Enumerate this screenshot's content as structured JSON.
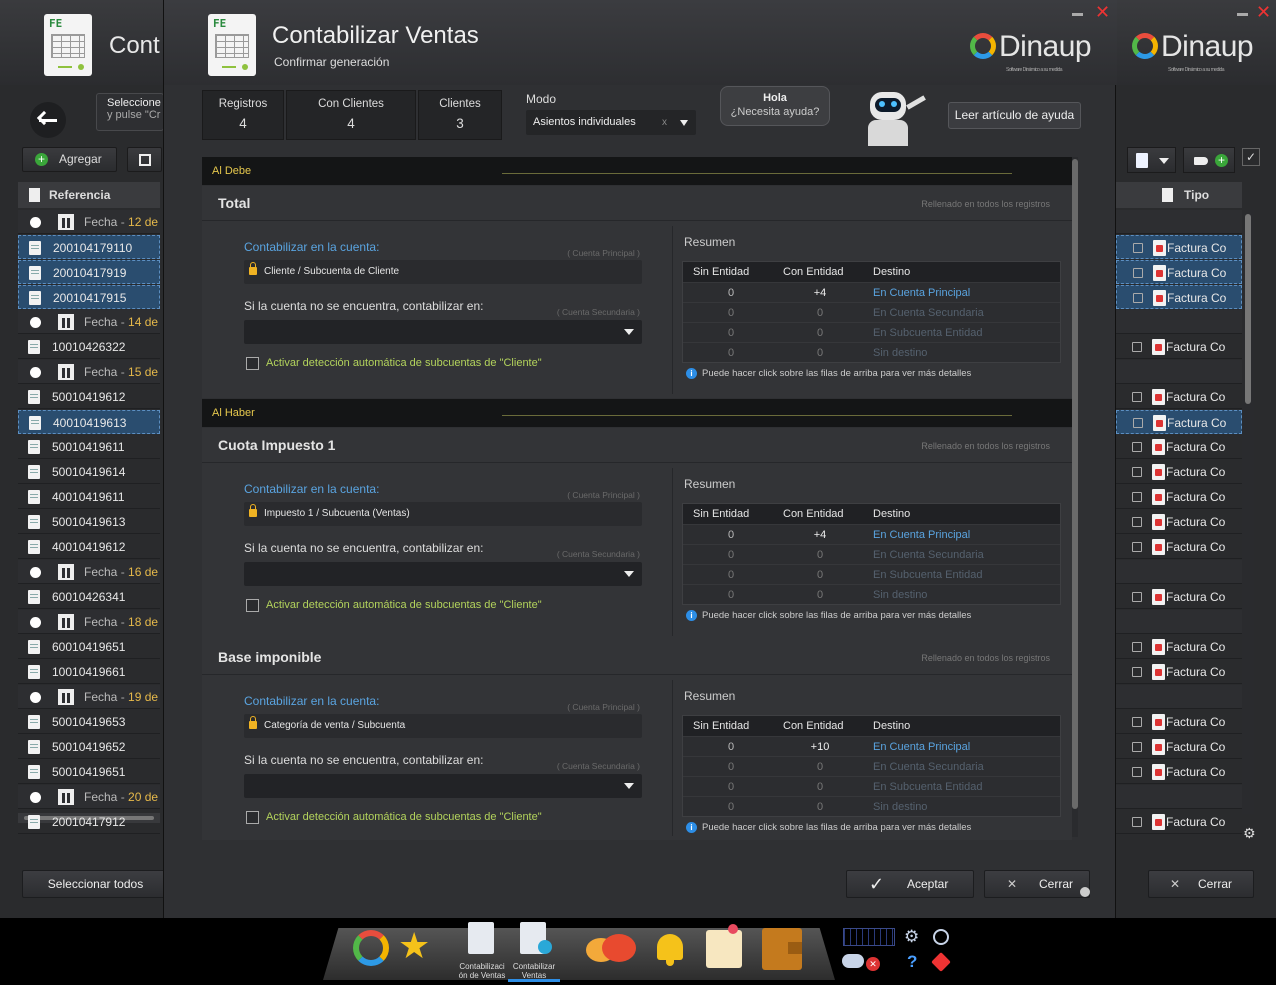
{
  "left_window": {
    "title": "Cont",
    "search_hint_line1": "Seleccione",
    "search_hint_line2": "y pulse \"Cr",
    "add_label": "Agregar",
    "col_header": "Referencia",
    "rows": [
      {
        "type": "group",
        "label": "Fecha",
        "date": "12 de"
      },
      {
        "type": "item",
        "ref": "200104179110",
        "selected": true
      },
      {
        "type": "item",
        "ref": "20010417919",
        "selected": true
      },
      {
        "type": "item",
        "ref": "20010417915",
        "selected": true
      },
      {
        "type": "group",
        "label": "Fecha",
        "date": "14 de"
      },
      {
        "type": "item",
        "ref": "10010426322",
        "selected": false
      },
      {
        "type": "group",
        "label": "Fecha",
        "date": "15 de"
      },
      {
        "type": "item",
        "ref": "50010419612",
        "selected": false
      },
      {
        "type": "item",
        "ref": "40010419613",
        "selected": true
      },
      {
        "type": "item",
        "ref": "50010419611",
        "selected": false
      },
      {
        "type": "item",
        "ref": "50010419614",
        "selected": false
      },
      {
        "type": "item",
        "ref": "40010419611",
        "selected": false
      },
      {
        "type": "item",
        "ref": "50010419613",
        "selected": false
      },
      {
        "type": "item",
        "ref": "40010419612",
        "selected": false
      },
      {
        "type": "group",
        "label": "Fecha",
        "date": "16 de"
      },
      {
        "type": "item",
        "ref": "60010426341",
        "selected": false
      },
      {
        "type": "group",
        "label": "Fecha",
        "date": "18 de"
      },
      {
        "type": "item",
        "ref": "60010419651",
        "selected": false
      },
      {
        "type": "item",
        "ref": "10010419661",
        "selected": false
      },
      {
        "type": "group",
        "label": "Fecha",
        "date": "19 de"
      },
      {
        "type": "item",
        "ref": "50010419653",
        "selected": false
      },
      {
        "type": "item",
        "ref": "50010419652",
        "selected": false
      },
      {
        "type": "item",
        "ref": "50010419651",
        "selected": false
      },
      {
        "type": "group",
        "label": "Fecha",
        "date": "20 de"
      },
      {
        "type": "item",
        "ref": "20010417912",
        "selected": false
      }
    ],
    "select_all_label": "Seleccionar todos"
  },
  "right_window": {
    "brand": "Dinaup",
    "brand_tag": "Software Dinámico a su medida",
    "col_header": "Tipo",
    "row_label": "Factura Co",
    "close_label": "Cerrar"
  },
  "dialog": {
    "title": "Contabilizar Ventas",
    "subtitle": "Confirmar generación",
    "brand": "Dinaup",
    "brand_tag": "Software Dinámico a su medida",
    "stats": [
      {
        "label": "Registros",
        "value": "4"
      },
      {
        "label": "Con Clientes",
        "value": "4"
      },
      {
        "label": "Clientes",
        "value": "3"
      }
    ],
    "mode_label": "Modo",
    "mode_value": "Asientos individuales",
    "mode_clear": "x",
    "help_bubble_line1": "Hola",
    "help_bubble_line2": "¿Necesita ayuda?",
    "help_button": "Leer artículo de ayuda",
    "section_debe": "Al Debe",
    "section_haber": "Al Haber",
    "filled_note": "Rellenado en todos los registros",
    "account_label": "Contabilizar en la cuenta:",
    "primary_hint": "( Cuenta Principal )",
    "fallback_label": "Si la cuenta no se encuentra, contabilizar en:",
    "secondary_hint": "( Cuenta Secundaria )",
    "auto_detect": "Activar detección automática de subcuentas de \"Cliente\"",
    "summary_title": "Resumen",
    "summary_headers": [
      "Sin Entidad",
      "Con Entidad",
      "Destino"
    ],
    "summary_info": "Puede hacer click sobre las filas de arriba para ver más detalles",
    "blocks": [
      {
        "title": "Total",
        "account": "Cliente / Subcuenta de Cliente",
        "rows": [
          [
            "0",
            "+4",
            "En Cuenta Principal"
          ],
          [
            "0",
            "0",
            "En Cuenta Secundaria"
          ],
          [
            "0",
            "0",
            "En Subcuenta Entidad"
          ],
          [
            "0",
            "0",
            "Sin destino"
          ]
        ]
      },
      {
        "title": "Cuota Impuesto 1",
        "account": "Impuesto 1 / Subcuenta (Ventas)",
        "rows": [
          [
            "0",
            "+4",
            "En Cuenta Principal"
          ],
          [
            "0",
            "0",
            "En Cuenta Secundaria"
          ],
          [
            "0",
            "0",
            "En Subcuenta Entidad"
          ],
          [
            "0",
            "0",
            "Sin destino"
          ]
        ]
      },
      {
        "title": "Base imponible",
        "account": "Categoría de venta / Subcuenta",
        "rows": [
          [
            "0",
            "+10",
            "En Cuenta Principal"
          ],
          [
            "0",
            "0",
            "En Cuenta Secundaria"
          ],
          [
            "0",
            "0",
            "En Subcuenta Entidad"
          ],
          [
            "0",
            "0",
            "Sin destino"
          ]
        ]
      }
    ],
    "accept_label": "Aceptar",
    "close_label": "Cerrar"
  },
  "taskbar": {
    "item1_label_line1": "Contabilizaci",
    "item1_label_line2": "ón de Ventas",
    "item2_label_line1": "Contabilizar",
    "item2_label_line2": "Ventas",
    "help_glyph": "?"
  },
  "colors": {
    "accent_blue": "#5aa4e0",
    "accent_green": "#b3d35c",
    "accent_yellow": "#e6c84d",
    "selection": "#2a4d6f"
  }
}
